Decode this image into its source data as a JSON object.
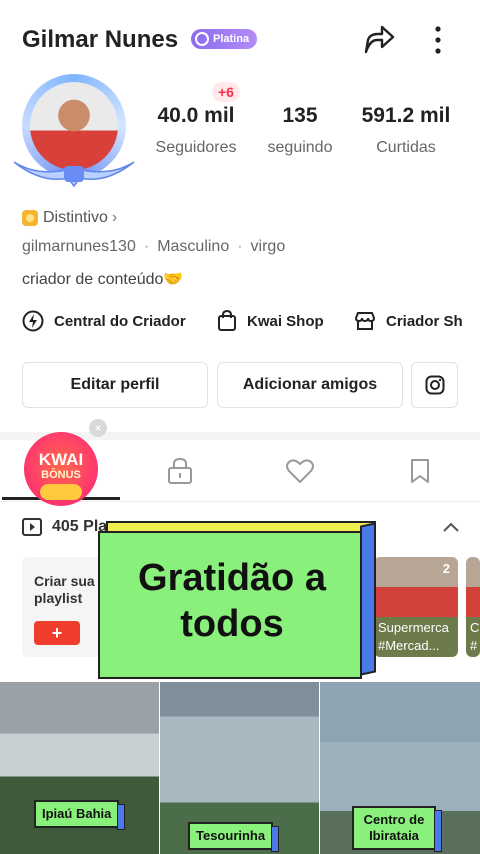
{
  "header": {
    "name": "Gilmar Nunes",
    "badge": "Platina"
  },
  "profile": {
    "new_followers": "+6",
    "stats": [
      {
        "value": "40.0 mil",
        "label": "Seguidores"
      },
      {
        "value": "135",
        "label": "seguindo"
      },
      {
        "value": "591.2 mil",
        "label": "Curtidas"
      }
    ],
    "distintivo": "Distintivo",
    "username": "gilmarnunes130",
    "gender": "Masculino",
    "sign": "virgo",
    "bio": "criador de conteúdo🤝"
  },
  "links": [
    {
      "label": "Central do Criador",
      "icon": "lightning-icon"
    },
    {
      "label": "Kwai Shop",
      "icon": "shopping-bag-icon"
    },
    {
      "label": "Criador Sh",
      "icon": "store-icon"
    }
  ],
  "actions": {
    "edit": "Editar perfil",
    "add_friends": "Adicionar amigos",
    "instagram_icon": "instagram-icon"
  },
  "promo": {
    "title": "KWAI",
    "subtitle": "BÔNUS",
    "close": "×"
  },
  "playlists": {
    "count_label": "405 Pla",
    "create_label": "Criar sua playlist",
    "create_button": "+",
    "items": [
      {
        "count": "2",
        "title": "Supermerca",
        "subtitle": "#Mercad..."
      },
      {
        "count": "",
        "title": "C",
        "subtitle": "#"
      }
    ]
  },
  "overlay_banner": {
    "text": "Gratidão a todos"
  },
  "videos": [
    {
      "label": "Ipiaú Bahia"
    },
    {
      "label": "Tesourinha"
    },
    {
      "label": "Centro de Ibirataia"
    }
  ],
  "colors": {
    "accent_red": "#f03c2b",
    "platina": "#8a6cf0",
    "banner_green": "#8af07c",
    "banner_yellow": "#f1ef4f",
    "banner_blue": "#4a79e8"
  }
}
